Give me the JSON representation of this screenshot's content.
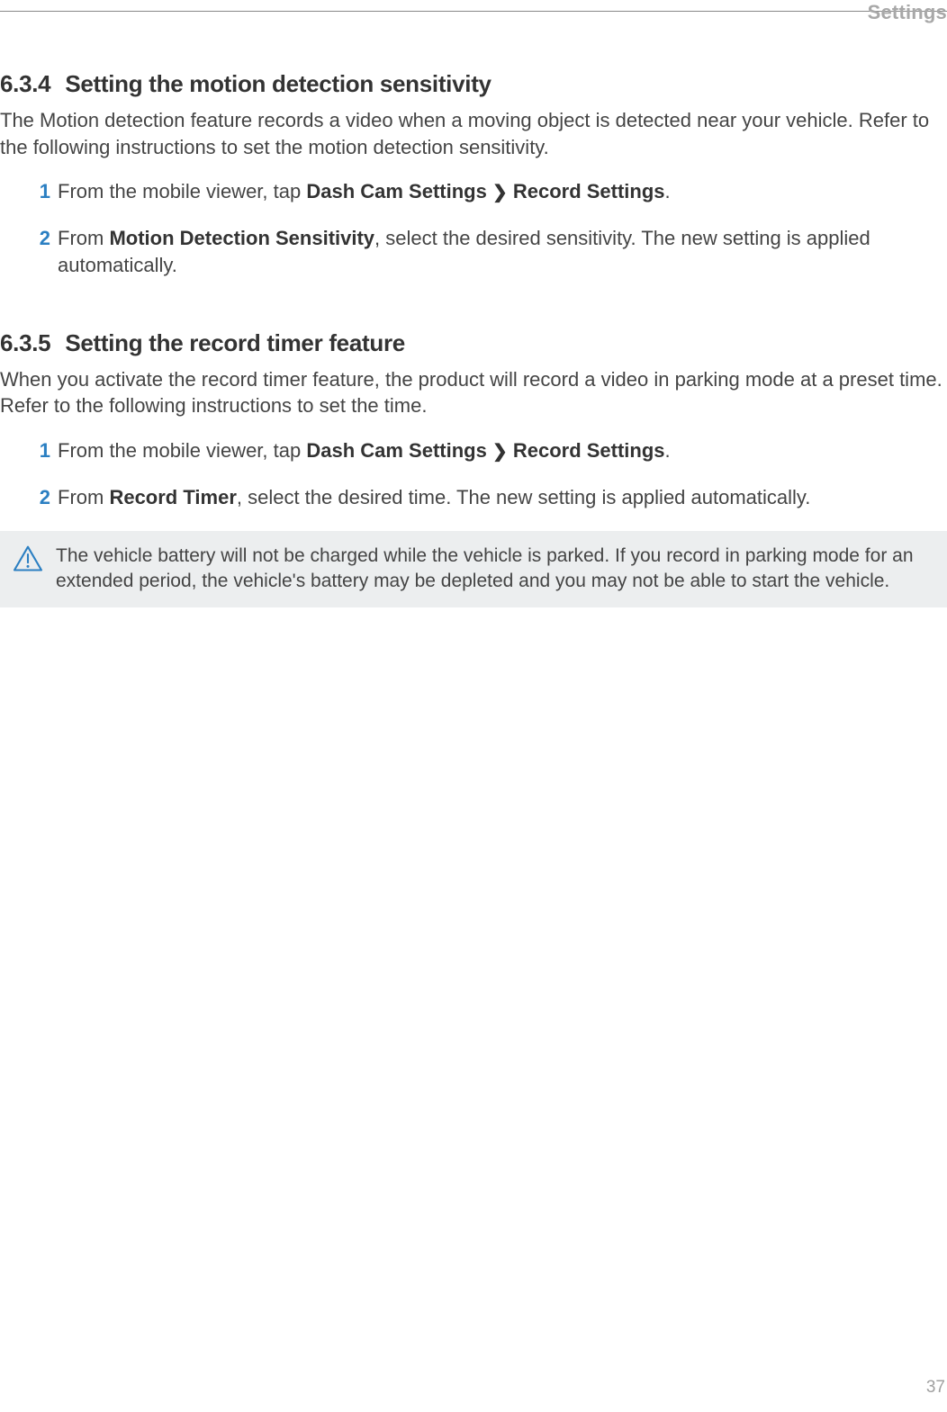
{
  "header": {
    "label": "Settings"
  },
  "sections": {
    "s1": {
      "number": "6.3.4",
      "title": "Setting the motion detection sensitivity",
      "intro": "The Motion detection feature records a video when a moving object is detected near your vehicle. Refer to the following instructions to set the motion detection sensitivity.",
      "step1_num": "1",
      "step1_pre": "From the mobile viewer, tap ",
      "step1_b1": "Dash Cam Settings ",
      "step1_b2": " Record Settings",
      "step1_post": ".",
      "step2_num": "2",
      "step2_pre": "From ",
      "step2_b": "Motion Detection Sensitivity",
      "step2_post": ", select the desired sensitivity. The new setting is applied automatically."
    },
    "s2": {
      "number": "6.3.5",
      "title": "Setting the record timer feature",
      "intro": "When you activate the record timer feature, the product will record a video in parking mode at a preset time. Refer to the following instructions to set the time.",
      "step1_num": "1",
      "step1_pre": "From the mobile viewer, tap ",
      "step1_b1": "Dash Cam Settings ",
      "step1_b2": " Record Settings",
      "step1_post": ".",
      "step2_num": "2",
      "step2_pre": "From ",
      "step2_b": "Record Timer",
      "step2_post": ", select the desired time. The new setting is applied automatically."
    }
  },
  "caution": {
    "text": "The vehicle battery will not be charged while the vehicle is parked. If you record in parking mode for an extended period, the vehicle's battery may be depleted and you may not be able to start the vehicle."
  },
  "page_number": "37"
}
